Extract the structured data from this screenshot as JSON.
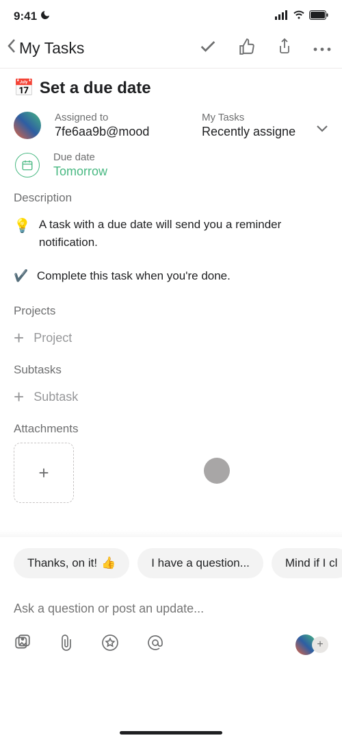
{
  "status": {
    "time": "9:41"
  },
  "header": {
    "title": "My Tasks"
  },
  "task": {
    "emoji_icon_name": "calendar-emoji",
    "title": "Set a due date"
  },
  "assignee": {
    "label": "Assigned to",
    "value": "7fe6aa9b@mood"
  },
  "project_field": {
    "label": "My Tasks",
    "value": "Recently assigne"
  },
  "due": {
    "label": "Due date",
    "value": "Tomorrow"
  },
  "description": {
    "label": "Description",
    "line1": "A task with a due date will send you a reminder notification.",
    "line2": "Complete this task when you're done."
  },
  "projects": {
    "label": "Projects",
    "add_label": "Project"
  },
  "subtasks": {
    "label": "Subtasks",
    "add_label": "Subtask"
  },
  "attachments": {
    "label": "Attachments"
  },
  "chips": {
    "c1": "Thanks, on it!",
    "c2": "I have a question...",
    "c3": "Mind if I cl"
  },
  "composer": {
    "placeholder": "Ask a question or post an update..."
  }
}
